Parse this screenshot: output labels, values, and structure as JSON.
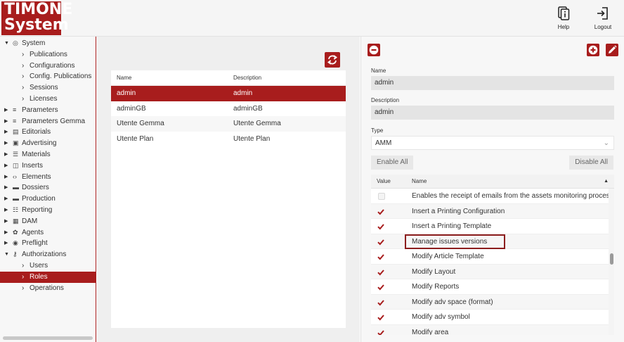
{
  "header": {
    "logo_line1": "TIMONE",
    "logo_line2": "System",
    "help_label": "Help",
    "logout_label": "Logout"
  },
  "sidebar": {
    "items": [
      {
        "label": "System",
        "level": 0,
        "arrow": "▼",
        "icon": "gauge-icon",
        "glyph": "◎"
      },
      {
        "label": "Publications",
        "level": 1,
        "arrow": "›"
      },
      {
        "label": "Configurations",
        "level": 1,
        "arrow": "›"
      },
      {
        "label": "Config. Publications",
        "level": 1,
        "arrow": "›"
      },
      {
        "label": "Sessions",
        "level": 1,
        "arrow": "›"
      },
      {
        "label": "Licenses",
        "level": 1,
        "arrow": "›"
      },
      {
        "label": "Parameters",
        "level": 0,
        "arrow": "▶",
        "icon": "sliders-icon",
        "glyph": "≡"
      },
      {
        "label": "Parameters Gemma",
        "level": 0,
        "arrow": "▶",
        "icon": "sliders-icon",
        "glyph": "≡"
      },
      {
        "label": "Editorials",
        "level": 0,
        "arrow": "▶",
        "icon": "book-icon",
        "glyph": "▤"
      },
      {
        "label": "Advertising",
        "level": 0,
        "arrow": "▶",
        "icon": "ad-icon",
        "glyph": "▣"
      },
      {
        "label": "Materials",
        "level": 0,
        "arrow": "▶",
        "icon": "database-icon",
        "glyph": "☰"
      },
      {
        "label": "Inserts",
        "level": 0,
        "arrow": "▶",
        "icon": "open-book-icon",
        "glyph": "◫"
      },
      {
        "label": "Elements",
        "level": 0,
        "arrow": "▶",
        "icon": "code-icon",
        "glyph": "‹›"
      },
      {
        "label": "Dossiers",
        "level": 0,
        "arrow": "▶",
        "icon": "folder-icon",
        "glyph": "▬"
      },
      {
        "label": "Production",
        "level": 0,
        "arrow": "▶",
        "icon": "truck-icon",
        "glyph": "▬"
      },
      {
        "label": "Reporting",
        "level": 0,
        "arrow": "▶",
        "icon": "list-icon",
        "glyph": "☷"
      },
      {
        "label": "DAM",
        "level": 0,
        "arrow": "▶",
        "icon": "storage-icon",
        "glyph": "▦"
      },
      {
        "label": "Agents",
        "level": 0,
        "arrow": "▶",
        "icon": "gear-icon",
        "glyph": "✿"
      },
      {
        "label": "Preflight",
        "level": 0,
        "arrow": "▶",
        "icon": "eye-icon",
        "glyph": "◉"
      },
      {
        "label": "Authorizations",
        "level": 0,
        "arrow": "▼",
        "icon": "key-icon",
        "glyph": "⚷"
      },
      {
        "label": "Users",
        "level": 1,
        "arrow": "›"
      },
      {
        "label": "Roles",
        "level": 1,
        "arrow": "›",
        "selected": true
      },
      {
        "label": "Operations",
        "level": 1,
        "arrow": "›"
      }
    ]
  },
  "roles_table": {
    "col_name": "Name",
    "col_description": "Description",
    "rows": [
      {
        "name": "admin",
        "description": "admin",
        "selected": true
      },
      {
        "name": "adminGB",
        "description": "adminGB"
      },
      {
        "name": "Utente Gemma",
        "description": "Utente Gemma"
      },
      {
        "name": "Utente Plan",
        "description": "Utente Plan"
      }
    ]
  },
  "detail": {
    "name_label": "Name",
    "name_value": "admin",
    "description_label": "Description",
    "description_value": "admin",
    "type_label": "Type",
    "type_value": "AMM",
    "enable_all": "Enable All",
    "disable_all": "Disable All",
    "perm_col_value": "Value",
    "perm_col_name": "Name",
    "permissions": [
      {
        "name": "Enables the receipt of emails from the assets monitoring process",
        "checked": false
      },
      {
        "name": "Insert a Printing Configuration",
        "checked": true
      },
      {
        "name": "Insert a Printing Template",
        "checked": true
      },
      {
        "name": "Manage issues versions",
        "checked": true,
        "highlighted": true
      },
      {
        "name": "Modify Article Template",
        "checked": true
      },
      {
        "name": "Modify Layout",
        "checked": true
      },
      {
        "name": "Modify Reports",
        "checked": true
      },
      {
        "name": "Modify adv space (format)",
        "checked": true
      },
      {
        "name": "Modify adv symbol",
        "checked": true
      },
      {
        "name": "Modify area",
        "checked": true
      }
    ]
  },
  "colors": {
    "accent": "#a81d1d",
    "highlight_border": "#8c1d1d"
  }
}
